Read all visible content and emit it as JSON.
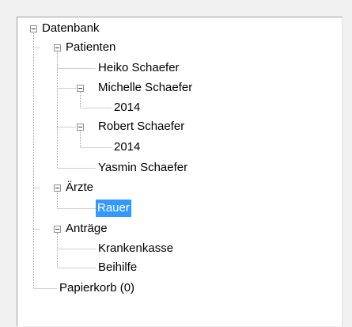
{
  "tree": {
    "root": "Datenbank",
    "patients_group": "Patienten",
    "patients": [
      "Heiko Schaefer",
      "Michelle Schaefer",
      "Robert Schaefer",
      "Yasmin Schaefer"
    ],
    "michelle_year": "2014",
    "robert_year": "2014",
    "doctors_group": "Ärzte",
    "doctor_selected": "Rauer",
    "applications_group": "Anträge",
    "applications": [
      "Krankenkasse",
      "Beihilfe"
    ],
    "trash": "Papierkorb (0)"
  },
  "colors": {
    "selection": "#3399ff",
    "connector": "#a0a0a0",
    "panel_bg": "#ffffff",
    "window_bg": "#f0f0f0"
  }
}
